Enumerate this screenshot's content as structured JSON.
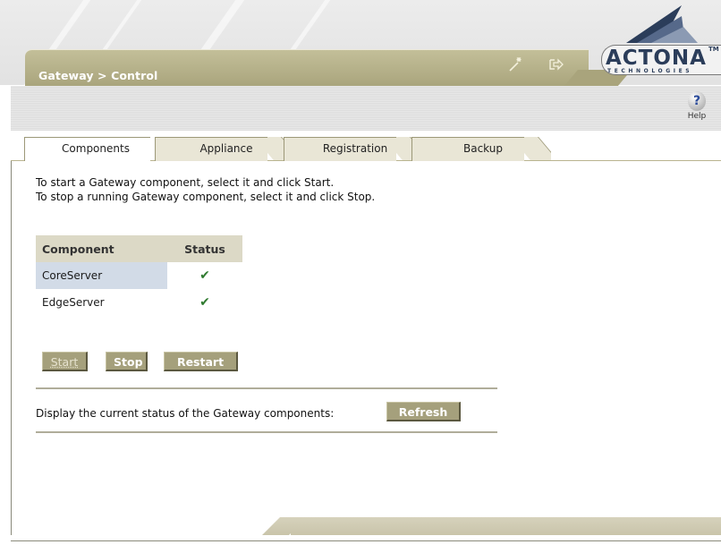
{
  "header": {
    "breadcrumb": "Gateway > Control",
    "logo_text": "ACTONA",
    "logo_tm": "TM",
    "logo_sub": "TECHNOLOGIES",
    "help_label": "Help",
    "icons": [
      "wizard-icon",
      "logout-icon",
      "help-icon"
    ]
  },
  "tabs": [
    {
      "label": "Components",
      "active": true
    },
    {
      "label": "Appliance",
      "active": false
    },
    {
      "label": "Registration",
      "active": false
    },
    {
      "label": "Backup",
      "active": false
    }
  ],
  "instructions": {
    "line1": "To start a Gateway component, select it and click Start.",
    "line2": "To stop a running Gateway component, select it and click Stop."
  },
  "table": {
    "headers": [
      "Component",
      "Status"
    ],
    "rows": [
      {
        "component": "CoreServer",
        "status": "✔",
        "selected": true
      },
      {
        "component": "EdgeServer",
        "status": "✔",
        "selected": false
      }
    ]
  },
  "buttons": {
    "start": "Start",
    "stop": "Stop",
    "restart": "Restart",
    "refresh": "Refresh"
  },
  "refresh_text": "Display the current status of the Gateway components:",
  "colors": {
    "olive": "#a5a07c",
    "header_olive": "#b5b08a",
    "selected_row": "#d2dbe7",
    "status_green": "#2f7a2f"
  }
}
